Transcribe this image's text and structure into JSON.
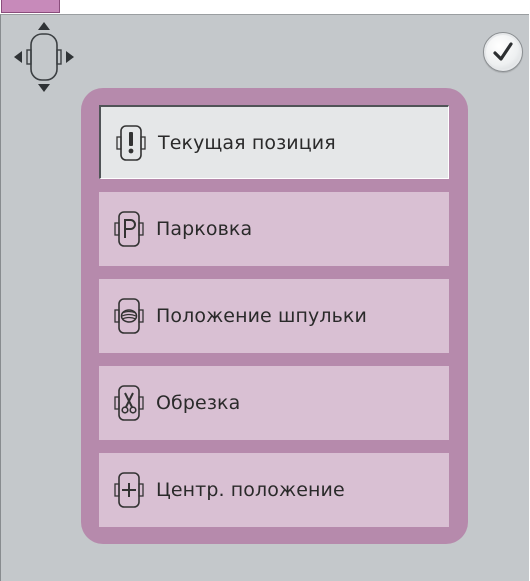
{
  "menu": {
    "items": [
      {
        "label": "Текущая позиция",
        "icon": "current-position-hoop-icon",
        "selected": true
      },
      {
        "label": "Парковка",
        "icon": "park-hoop-icon",
        "selected": false
      },
      {
        "label": "Положение шпульки",
        "icon": "bobbin-hoop-icon",
        "selected": false
      },
      {
        "label": "Обрезка",
        "icon": "cut-hoop-icon",
        "selected": false
      },
      {
        "label": "Центр. положение",
        "icon": "center-hoop-icon",
        "selected": false
      }
    ]
  },
  "colors": {
    "panel_bg": "#c4c8cb",
    "frame": "#b68aac",
    "item": "#d9c0d3",
    "selected_item": "#e5e7e8",
    "tab": "#c78aba"
  }
}
